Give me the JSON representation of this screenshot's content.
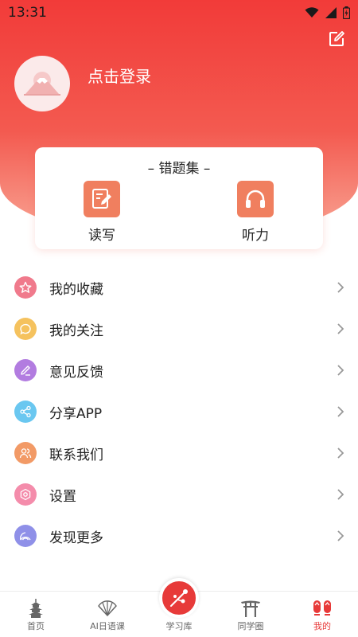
{
  "status_bar": {
    "time": "13:31"
  },
  "profile": {
    "login_text": "点击登录"
  },
  "wrong_set": {
    "title": "– 错题集 –",
    "items": [
      {
        "label": "读写",
        "icon": "pencil-note-icon"
      },
      {
        "label": "听力",
        "icon": "headphones-icon"
      }
    ]
  },
  "menu": {
    "items": [
      {
        "label": "我的收藏",
        "icon": "star-icon",
        "color": "#f07a8c"
      },
      {
        "label": "我的关注",
        "icon": "chat-bubble-icon",
        "color": "#f5c25e"
      },
      {
        "label": "意见反馈",
        "icon": "pen-icon",
        "color": "#b27ce0"
      },
      {
        "label": "分享APP",
        "icon": "share-icon",
        "color": "#6ac7f0"
      },
      {
        "label": "联系我们",
        "icon": "contacts-icon",
        "color": "#f29a66"
      },
      {
        "label": "设置",
        "icon": "gear-icon",
        "color": "#f48cab"
      },
      {
        "label": "发现更多",
        "icon": "discover-icon",
        "color": "#8f90e8"
      }
    ]
  },
  "tabbar": {
    "tabs": [
      {
        "label": "首页",
        "icon": "tower-icon"
      },
      {
        "label": "AI日语课",
        "icon": "fan-icon"
      },
      {
        "label": "学习库",
        "icon": "sakura-branch-icon"
      },
      {
        "label": "同学圈",
        "icon": "torii-icon"
      },
      {
        "label": "我的",
        "icon": "geta-icon"
      }
    ],
    "active_color": "#e73a39"
  }
}
